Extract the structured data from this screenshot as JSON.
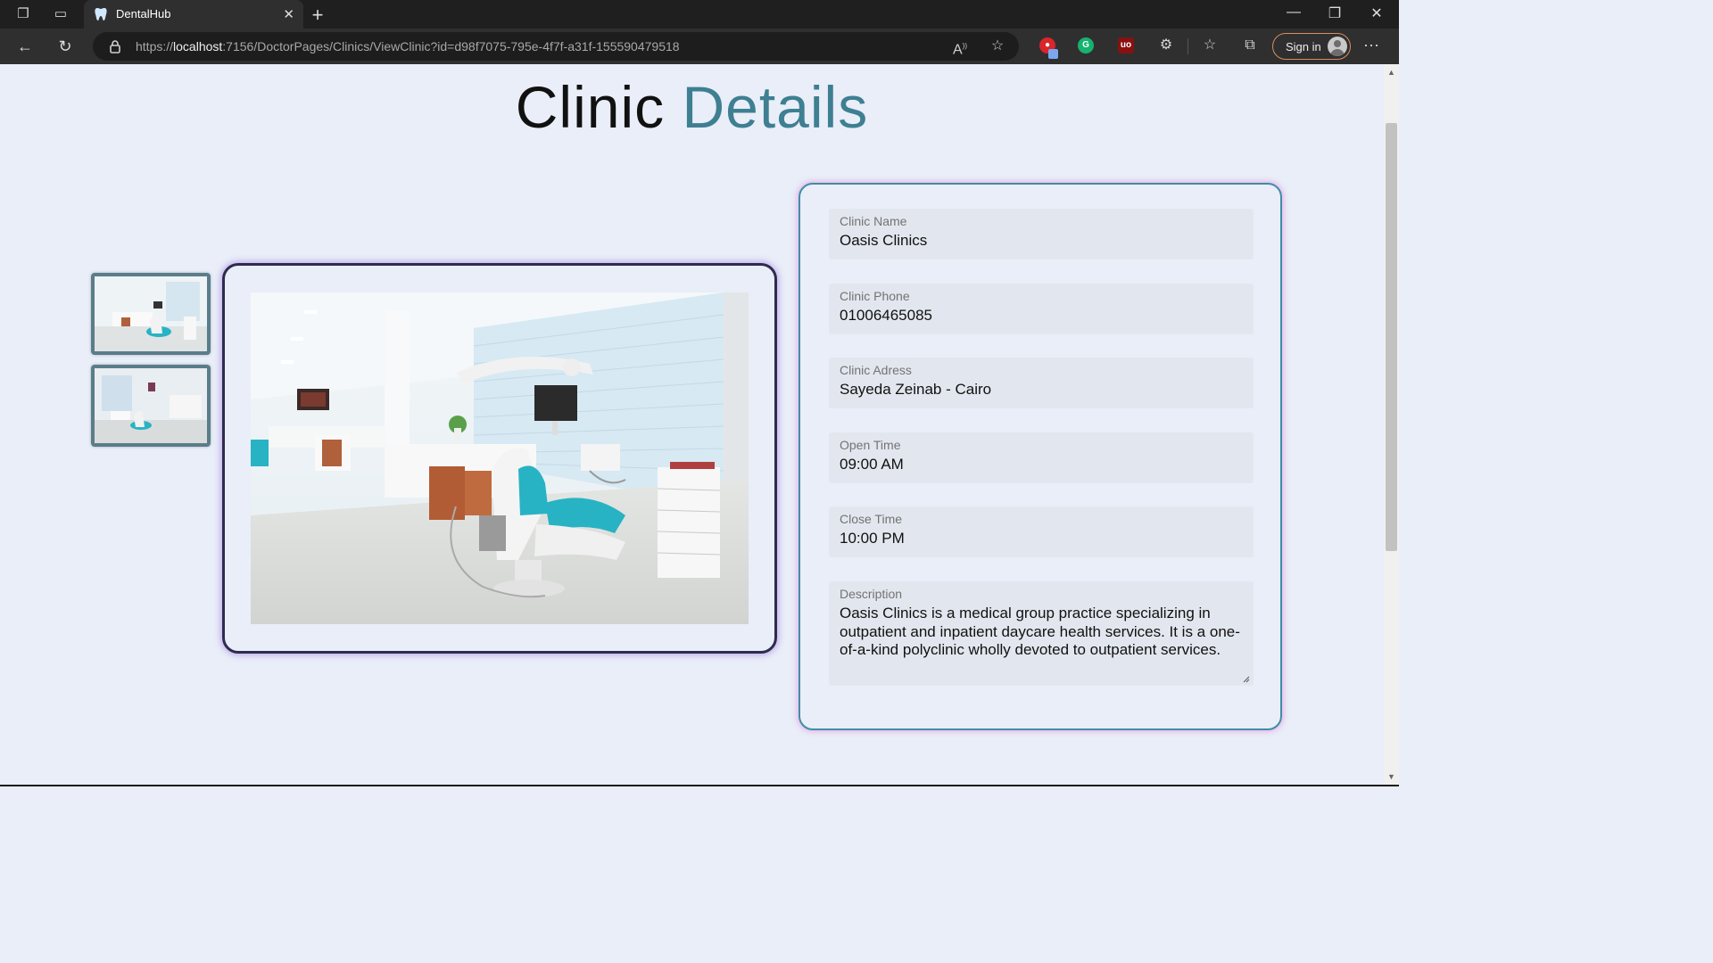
{
  "browser": {
    "tab": {
      "title": "DentalHub"
    },
    "url": {
      "prefix": "https://",
      "host": "localhost",
      "rest": ":7156/DoctorPages/Clinics/ViewClinic?id=d98f7075-795e-4f7f-a31f-155590479518"
    },
    "signin_label": "Sign in"
  },
  "page": {
    "title_part1": "Clinic",
    "title_part2": "Details"
  },
  "gallery": {
    "thumbnails": [
      "clinic-photo-1",
      "clinic-photo-2"
    ],
    "main_image": "clinic-photo-1"
  },
  "details": {
    "name": {
      "label": "Clinic Name",
      "value": "Oasis Clinics"
    },
    "phone": {
      "label": "Clinic Phone",
      "value": "01006465085"
    },
    "address": {
      "label": "Clinic Adress",
      "value": "Sayeda Zeinab - Cairo"
    },
    "open_time": {
      "label": "Open Time",
      "value": "09:00 AM"
    },
    "close_time": {
      "label": "Close Time",
      "value": "10:00 PM"
    },
    "description": {
      "label": "Description",
      "value": "Oasis Clinics is a medical group practice specializing in outpatient and inpatient daycare health services. It is a one-of-a-kind polyclinic wholly devoted to outpatient services."
    }
  },
  "colors": {
    "accent": "#3e7f92",
    "page_bg": "#e9eef8",
    "chair_teal": "#27b3c4"
  }
}
